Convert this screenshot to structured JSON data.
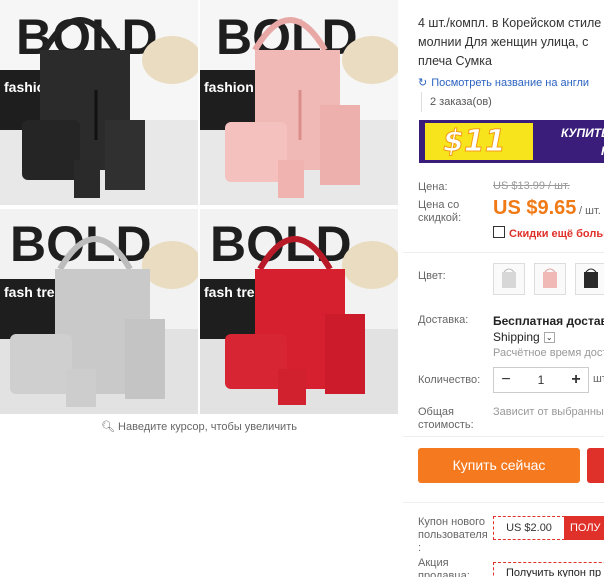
{
  "gallery": {
    "tiles": [
      {
        "brand": "BOLD",
        "sign": "fashion",
        "color": "#2a2a2a"
      },
      {
        "brand": "BOLD",
        "sign": "fashion",
        "color": "#f1b9b6"
      },
      {
        "brand": "BOLD",
        "sign": "fash tre",
        "color": "#c9c9c9"
      },
      {
        "brand": "BOLD",
        "sign": "fash tre",
        "color": "#d6202f"
      }
    ],
    "zoom_hint": "Наведите курсор, чтобы увеличить"
  },
  "product": {
    "title": "4 шт./компл. в Корейском стиле молнии Для женщин улица, с плеча Сумка",
    "translate_link": "Посмотреть название на англи",
    "orders": "2 заказа(ов)"
  },
  "promo": {
    "price": "$11",
    "text1": "КУПИТЕ С",
    "text2": "НА"
  },
  "price": {
    "label": "Цена:",
    "old": "US $13.99 / шт.",
    "discount_label": "Цена со скидкой:",
    "new": "US $9.65",
    "unit": "/ шт.",
    "similar": "Скидки ещё больше"
  },
  "color": {
    "label": "Цвет:",
    "swatches": [
      "#d7d7d7",
      "#f1b9b6",
      "#2a2a2a"
    ]
  },
  "delivery": {
    "label": "Доставка:",
    "line1": "Бесплатная доставка",
    "line2": "Shipping",
    "line3": "Расчётное время дост"
  },
  "quantity": {
    "label": "Количество:",
    "value": "1",
    "unit": "шт"
  },
  "total": {
    "label": "Общая стоимость:",
    "value": "Зависит от выбранных"
  },
  "buttons": {
    "buy_now": "Купить сейчас"
  },
  "coupon": {
    "label": "Купон нового пользователя :",
    "amount": "US $2.00",
    "get": "ПОЛУ"
  },
  "promotion": {
    "label": "Акция продавца:",
    "text": "Получить купон пр"
  },
  "colors": {
    "accent": "#f5791f",
    "red": "#e0302a",
    "link": "#2b63c0",
    "promo_bg": "#3a1d7a",
    "promo_yellow": "#f8e41c"
  }
}
